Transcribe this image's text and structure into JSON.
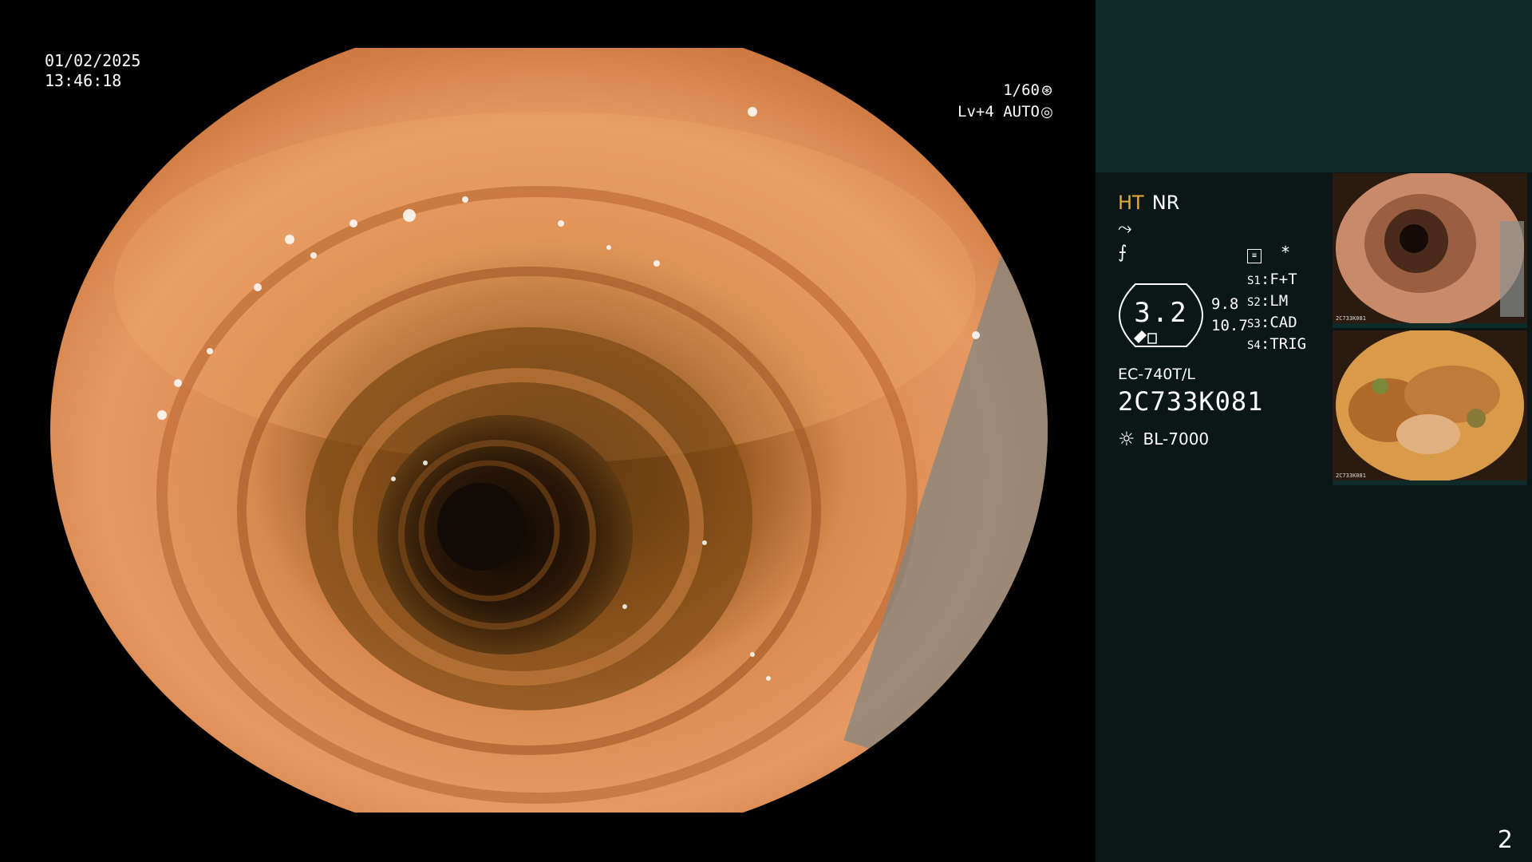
{
  "overlay": {
    "date": "01/02/2025",
    "time": "13:46:18",
    "shutter_speed": "1/60",
    "shutter_icon": "aperture-icon",
    "level": "Lv+4 AUTO",
    "level_icon": "iris-icon"
  },
  "side_panel": {
    "mode_ht": "HT",
    "mode_nr": "NR",
    "gauge_value": "3.2",
    "value_top": "9.8",
    "value_bottom": "10.7",
    "asterisk": "*",
    "switches": [
      {
        "key": "S1",
        "value": "F+T"
      },
      {
        "key": "S2",
        "value": "LM"
      },
      {
        "key": "S3",
        "value": "CAD"
      },
      {
        "key": "S4",
        "value": "TRIG"
      }
    ],
    "scope_model": "EC-740T/L",
    "serial": "2C733K081",
    "light_source": "BL-7000",
    "thumbnails": [
      {
        "caption": "2C733K081"
      },
      {
        "caption": "2C733K081"
      }
    ],
    "page_number": "2"
  },
  "colors": {
    "side_bg": "#0a1716",
    "side_top_bg": "#0e2b29",
    "ht_accent": "#e8a93c"
  }
}
